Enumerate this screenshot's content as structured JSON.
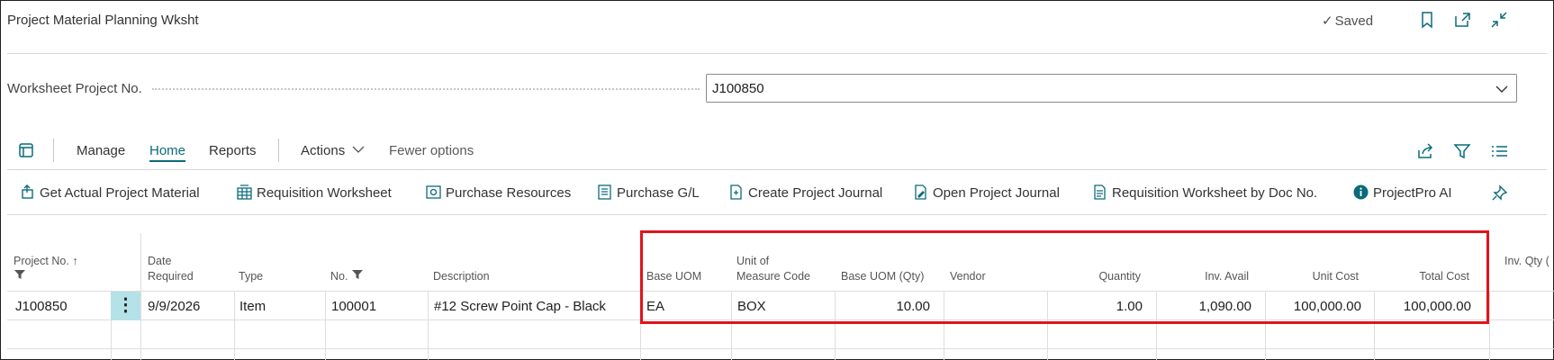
{
  "page": {
    "title": "Project Material Planning Wksht",
    "status": "Saved"
  },
  "field": {
    "label": "Worksheet Project No.",
    "value": "J100850"
  },
  "menu": {
    "manage": "Manage",
    "home": "Home",
    "reports": "Reports",
    "actions": "Actions",
    "fewer": "Fewer options"
  },
  "actions": [
    {
      "label": "Get Actual Project Material",
      "icon": "get-material-icon"
    },
    {
      "label": "Requisition Worksheet",
      "icon": "worksheet-icon"
    },
    {
      "label": "Purchase Resources",
      "icon": "purchase-resources-icon"
    },
    {
      "label": "Purchase G/L",
      "icon": "purchase-gl-icon"
    },
    {
      "label": "Create Project Journal",
      "icon": "create-journal-icon"
    },
    {
      "label": "Open Project Journal",
      "icon": "open-journal-icon"
    },
    {
      "label": "Requisition Worksheet by Doc No.",
      "icon": "document-icon"
    },
    {
      "label": "ProjectPro AI",
      "icon": "info-icon"
    }
  ],
  "columns": {
    "project_no": "Project No.",
    "date_required_1": "Date",
    "date_required_2": "Required",
    "type": "Type",
    "no": "No.",
    "description": "Description",
    "base_uom": "Base UOM",
    "unit_of_measure_1": "Unit of",
    "unit_of_measure_2": "Measure Code",
    "base_uom_qty": "Base UOM (Qty)",
    "vendor": "Vendor",
    "quantity": "Quantity",
    "inv_avail": "Inv. Avail",
    "unit_cost": "Unit Cost",
    "total_cost": "Total Cost",
    "inv_qty": "Inv. Qty ("
  },
  "row": {
    "project_no": "J100850",
    "date_required": "9/9/2026",
    "type": "Item",
    "no": "100001",
    "description": "#12 Screw Point Cap - Black",
    "base_uom": "EA",
    "unit_of_measure": "BOX",
    "base_uom_qty": "10.00",
    "vendor": "",
    "quantity": "1.00",
    "inv_avail": "1,090.00",
    "unit_cost": "100,000.00",
    "total_cost": "100,000.00"
  },
  "colors": {
    "accent": "#0a6b7a",
    "highlight_box": "#e0141b",
    "selected_row_marker": "#b4e2e6"
  }
}
